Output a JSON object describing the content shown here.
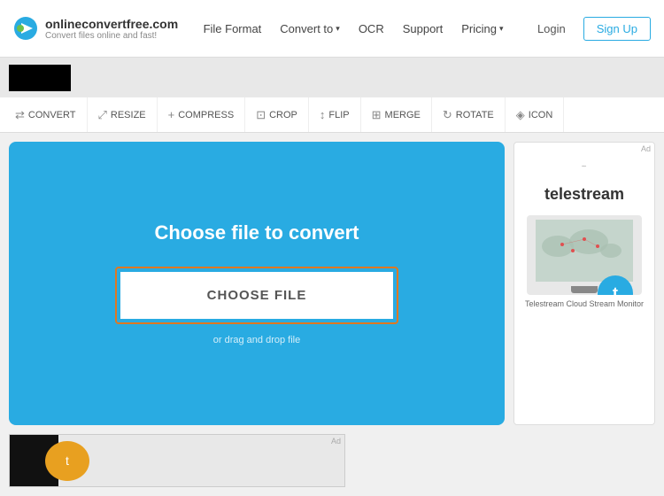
{
  "header": {
    "logo_name": "onlineconvertfree.com",
    "logo_tagline": "Convert files online and fast!",
    "nav_items": [
      {
        "id": "file-format",
        "label": "File Format",
        "has_chevron": false
      },
      {
        "id": "convert-to",
        "label": "Convert to",
        "has_chevron": true
      },
      {
        "id": "ocr",
        "label": "OCR",
        "has_chevron": false
      },
      {
        "id": "support",
        "label": "Support",
        "has_chevron": false
      },
      {
        "id": "pricing",
        "label": "Pricing",
        "has_chevron": true
      }
    ],
    "login_label": "Login",
    "signup_label": "Sign Up"
  },
  "tool_tabs": [
    {
      "id": "convert",
      "label": "CONVERT",
      "icon": "⇄"
    },
    {
      "id": "resize",
      "label": "RESIZE",
      "icon": "⤢"
    },
    {
      "id": "compress",
      "label": "COMPRESS",
      "icon": "+"
    },
    {
      "id": "crop",
      "label": "CROP",
      "icon": "⊡"
    },
    {
      "id": "flip",
      "label": "FLIP",
      "icon": "↕"
    },
    {
      "id": "merge",
      "label": "MERGE",
      "icon": "⊞"
    },
    {
      "id": "rotate",
      "label": "ROTATE",
      "icon": "↻"
    },
    {
      "id": "icon",
      "label": "ICON",
      "icon": "◈"
    }
  ],
  "convert_section": {
    "title": "Choose file to convert",
    "choose_file_label": "CHOOSE FILE",
    "drag_drop_label": "or drag and drop file"
  },
  "ad_sidebar": {
    "ad_label": "Ad",
    "brand": "telestream",
    "badge_letter": "t",
    "bottom_text": "Telestream Cloud Stream Monitor"
  },
  "bottom_ad": {
    "ad_label": "Ad"
  }
}
